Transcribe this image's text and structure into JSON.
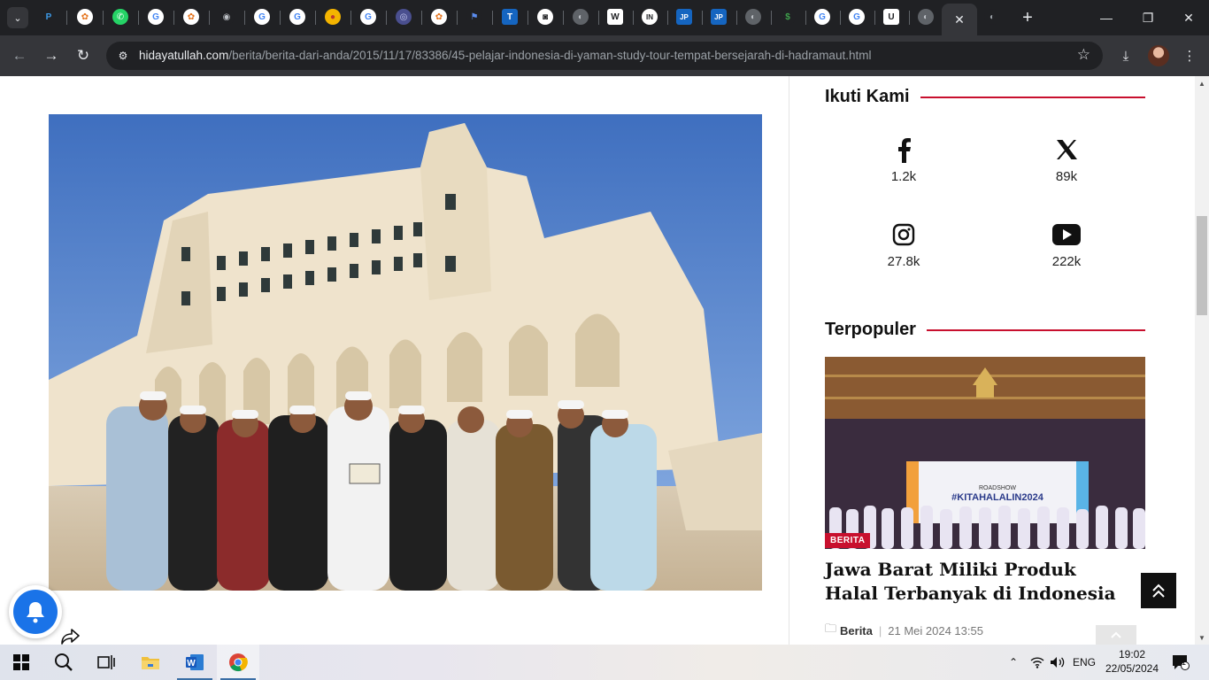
{
  "browser": {
    "tabs": [
      {
        "icon": "tab-favicon-p",
        "glyph": "P",
        "bg": "#202124",
        "fg": "#3d9be9"
      },
      {
        "icon": "tab-favicon-orange-flower",
        "glyph": "✿",
        "bg": "#ffffff",
        "fg": "#e5731c"
      },
      {
        "icon": "whatsapp-icon",
        "glyph": "✆",
        "bg": "#25d366",
        "fg": "#ffffff"
      },
      {
        "icon": "google-icon",
        "glyph": "G",
        "bg": "#ffffff",
        "fg": "#4285f4"
      },
      {
        "icon": "tab-favicon-orange-flower",
        "glyph": "✿",
        "bg": "#ffffff",
        "fg": "#e5731c"
      },
      {
        "icon": "chrome-icon",
        "glyph": "◉",
        "bg": "#202124",
        "fg": "#bdc1c6"
      },
      {
        "icon": "google-icon",
        "glyph": "G",
        "bg": "#ffffff",
        "fg": "#4285f4"
      },
      {
        "icon": "google-icon",
        "glyph": "G",
        "bg": "#ffffff",
        "fg": "#4285f4"
      },
      {
        "icon": "tab-favicon-yellow-square",
        "glyph": "●",
        "bg": "#f4b400",
        "fg": "#c0392b"
      },
      {
        "icon": "google-icon",
        "glyph": "G",
        "bg": "#ffffff",
        "fg": "#4285f4"
      },
      {
        "icon": "tab-favicon-globe-purple",
        "glyph": "◎",
        "bg": "#4a4f8f",
        "fg": "#c9cdf5"
      },
      {
        "icon": "tab-favicon-orange-flower",
        "glyph": "✿",
        "bg": "#ffffff",
        "fg": "#e5731c"
      },
      {
        "icon": "tab-favicon-flag",
        "glyph": "⚑",
        "bg": "#202124",
        "fg": "#5b8def"
      },
      {
        "icon": "tab-favicon-t",
        "glyph": "T",
        "bg": "#1565c0",
        "fg": "#ffffff"
      },
      {
        "icon": "tab-favicon-camera",
        "glyph": "◙",
        "bg": "#ffffff",
        "fg": "#202124"
      },
      {
        "icon": "globe-icon",
        "glyph": "◐",
        "bg": "#5f6368",
        "fg": "#bdc1c6"
      },
      {
        "icon": "wikipedia-icon",
        "glyph": "W",
        "bg": "#ffffff",
        "fg": "#202124"
      },
      {
        "icon": "tab-favicon-in",
        "glyph": "IN",
        "bg": "#ffffff",
        "fg": "#202124"
      },
      {
        "icon": "tab-favicon-jp",
        "glyph": "JP",
        "bg": "#1565c0",
        "fg": "#ffffff"
      },
      {
        "icon": "tab-favicon-jp",
        "glyph": "JP",
        "bg": "#1565c0",
        "fg": "#ffffff"
      },
      {
        "icon": "globe-icon",
        "glyph": "◐",
        "bg": "#5f6368",
        "fg": "#bdc1c6"
      },
      {
        "icon": "tab-favicon-dollar",
        "glyph": "$",
        "bg": "#202124",
        "fg": "#3fa34d"
      },
      {
        "icon": "google-icon",
        "glyph": "G",
        "bg": "#ffffff",
        "fg": "#4285f4"
      },
      {
        "icon": "google-icon",
        "glyph": "G",
        "bg": "#ffffff",
        "fg": "#4285f4"
      },
      {
        "icon": "tab-favicon-u",
        "glyph": "U",
        "bg": "#ffffff",
        "fg": "#202124"
      },
      {
        "icon": "globe-icon",
        "glyph": "◐",
        "bg": "#5f6368",
        "fg": "#bdc1c6"
      }
    ],
    "active_tab_close": "✕",
    "inactive_tab_icon": "globe-icon",
    "new_tab": "+",
    "url_host": "hidayatullah.com",
    "url_path": "/berita/berita-dari-anda/2015/11/17/83386/45-pelajar-indonesia-di-yaman-study-tour-tempat-bersejarah-di-hadramaut.html"
  },
  "sidebar": {
    "follow_heading": "Ikuti Kami",
    "social": [
      {
        "name": "facebook",
        "count": "1.2k"
      },
      {
        "name": "x",
        "count": "89k"
      },
      {
        "name": "instagram",
        "count": "27.8k"
      },
      {
        "name": "youtube",
        "count": "222k"
      }
    ],
    "popular_heading": "Terpopuler",
    "popular_item": {
      "badge": "BERITA",
      "banner_line1": "ROADSHOW",
      "banner_line2": "#KITAHALALIN2024",
      "title": "Jawa Barat Miliki Produk Halal Terbanyak di Indonesia",
      "category": "Berita",
      "date": "21 Mei 2024 13:55"
    }
  },
  "taskbar": {
    "language": "ENG",
    "time": "19:02",
    "date": "22/05/2024",
    "notification_count": "1"
  },
  "colors": {
    "accent_red": "#c8102e",
    "chrome_dark": "#202124",
    "chrome_toolbar": "#35363a"
  }
}
